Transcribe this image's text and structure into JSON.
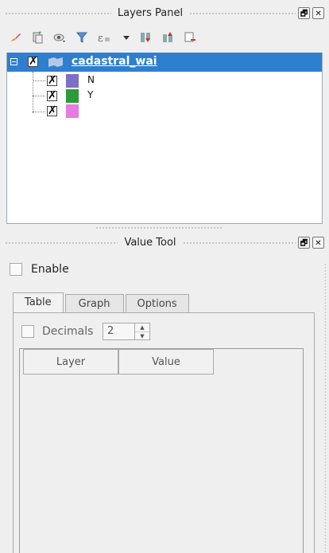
{
  "layers_panel": {
    "title": "Layers Panel",
    "toolbar_icons": [
      "style-brush-icon",
      "add-group-icon",
      "visibility-eye-icon",
      "filter-icon",
      "expression-filter-icon",
      "dropdown-arrow-icon",
      "expand-all-icon",
      "collapse-all-icon",
      "remove-layer-icon"
    ],
    "layer": {
      "name": "cadastral_wai",
      "items": [
        {
          "label": "N",
          "color": "#7d6fc6"
        },
        {
          "label": "Y",
          "color": "#2e9a3a"
        },
        {
          "label": "",
          "color": "#e77be0"
        }
      ]
    }
  },
  "value_tool": {
    "title": "Value Tool",
    "enable_label": "Enable",
    "tabs": [
      "Table",
      "Graph",
      "Options"
    ],
    "decimals_label": "Decimals",
    "decimals_value": "2",
    "columns": [
      "Layer",
      "Value"
    ]
  },
  "window_buttons": {
    "float": "🗗",
    "close": "✕"
  },
  "colors": {
    "selection": "#2f7fd0",
    "background": "#efefef"
  }
}
